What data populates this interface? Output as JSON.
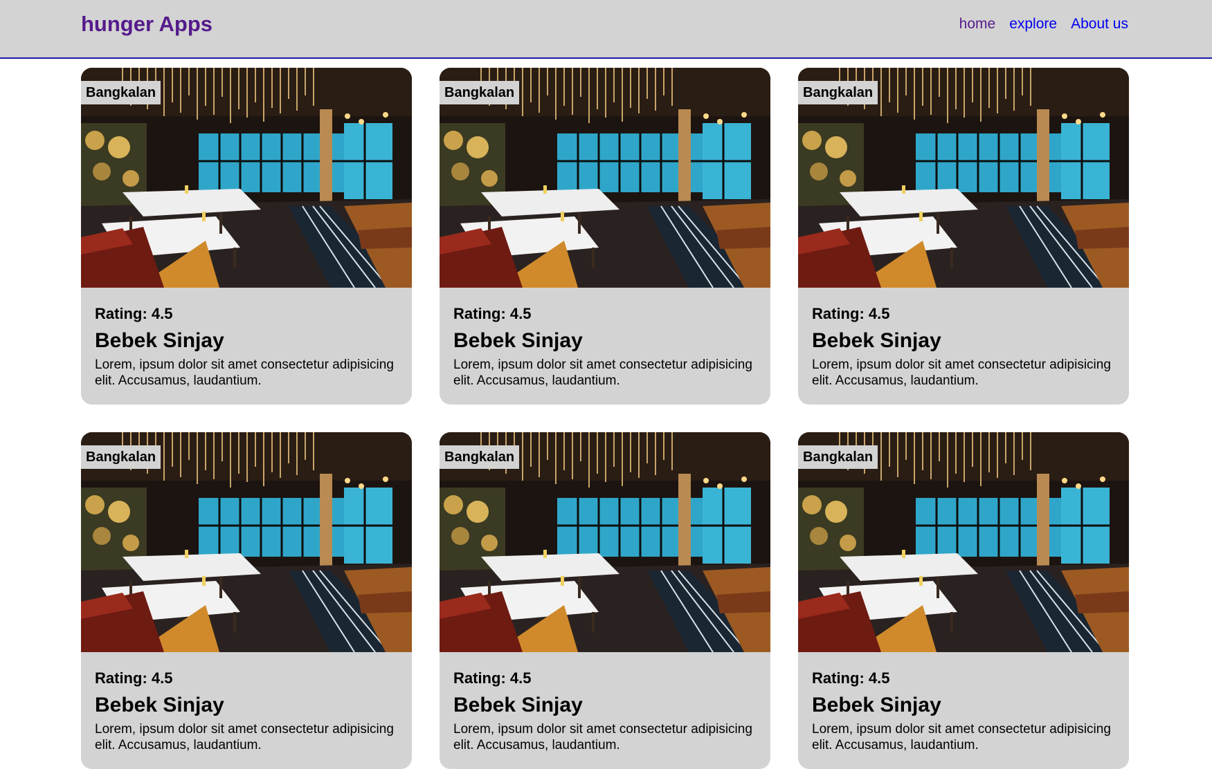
{
  "header": {
    "brand": "hunger Apps",
    "nav": [
      {
        "label": "home",
        "state": "visited"
      },
      {
        "label": "explore",
        "state": "link"
      },
      {
        "label": "About us",
        "state": "link"
      }
    ]
  },
  "restaurants": [
    {
      "city": "Bangkalan",
      "rating": "Rating: 4.5",
      "name": "Bebek Sinjay",
      "description": "Lorem, ipsum dolor sit amet consectetur adipisicing elit. Accusamus, laudantium."
    },
    {
      "city": "Bangkalan",
      "rating": "Rating: 4.5",
      "name": "Bebek Sinjay",
      "description": "Lorem, ipsum dolor sit amet consectetur adipisicing elit. Accusamus, laudantium."
    },
    {
      "city": "Bangkalan",
      "rating": "Rating: 4.5",
      "name": "Bebek Sinjay",
      "description": "Lorem, ipsum dolor sit amet consectetur adipisicing elit. Accusamus, laudantium."
    },
    {
      "city": "Bangkalan",
      "rating": "Rating: 4.5",
      "name": "Bebek Sinjay",
      "description": "Lorem, ipsum dolor sit amet consectetur adipisicing elit. Accusamus, laudantium."
    },
    {
      "city": "Bangkalan",
      "rating": "Rating: 4.5",
      "name": "Bebek Sinjay",
      "description": "Lorem, ipsum dolor sit amet consectetur adipisicing elit. Accusamus, laudantium."
    },
    {
      "city": "Bangkalan",
      "rating": "Rating: 4.5",
      "name": "Bebek Sinjay",
      "description": "Lorem, ipsum dolor sit amet consectetur adipisicing elit. Accusamus, laudantium."
    }
  ],
  "colors": {
    "header_bg": "#d3d3d3",
    "header_border": "#1a1aa8",
    "brand": "#551a8b",
    "visited_link": "#551a8b",
    "link": "#0000ee",
    "card_bg": "#d3d3d3"
  }
}
